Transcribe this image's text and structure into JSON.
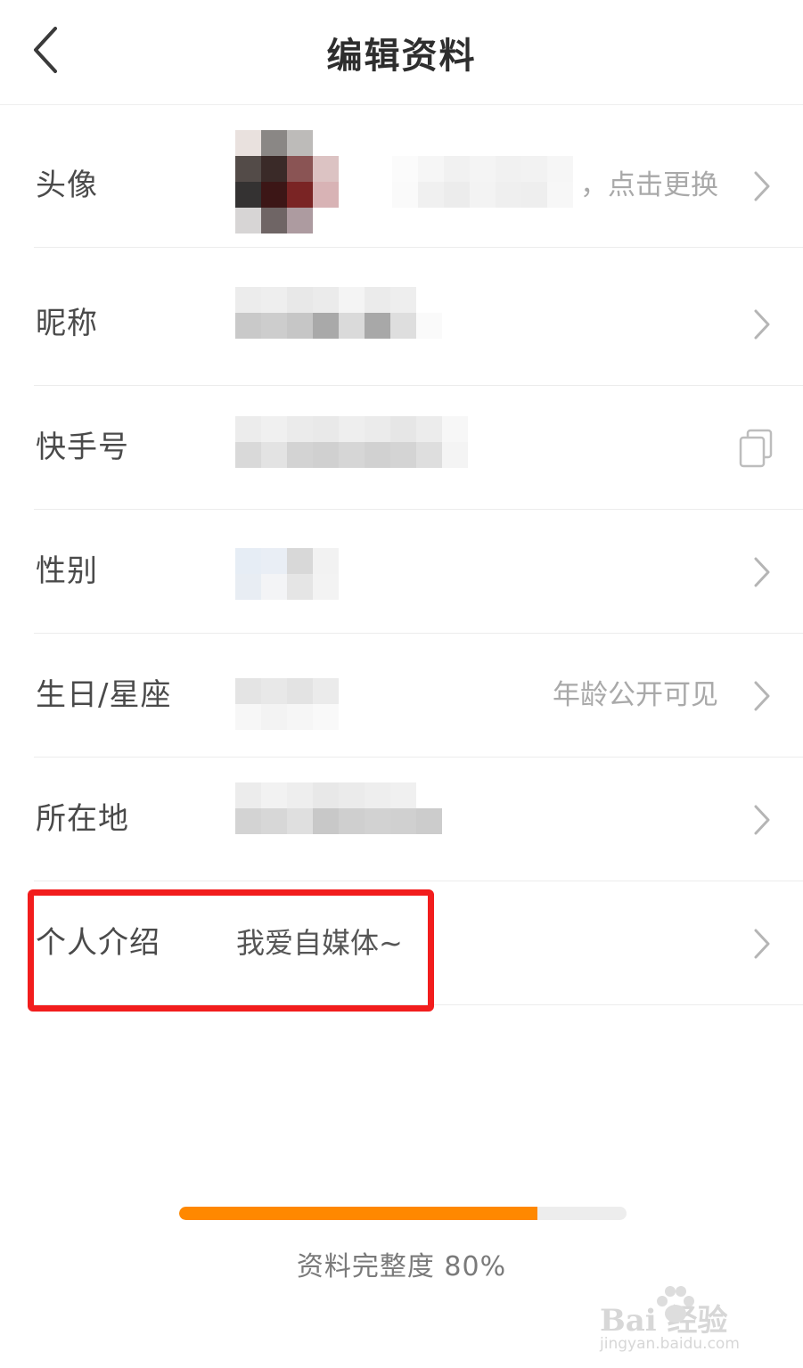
{
  "header": {
    "title": "编辑资料",
    "back_icon": "chevron-left-icon"
  },
  "rows": [
    {
      "label": "头像",
      "hint": "，点击更换"
    },
    {
      "label": "昵称"
    },
    {
      "label": "快手号"
    },
    {
      "label": "性别"
    },
    {
      "label": "生日/星座",
      "hint": "年龄公开可见"
    },
    {
      "label": "所在地"
    },
    {
      "label": "个人介绍",
      "value": "我爱自媒体~"
    }
  ],
  "progress": {
    "label": "资料完整度 80%",
    "fraction": 0.8,
    "color": "#ff8800"
  },
  "highlight": {
    "color": "#f21d1d"
  },
  "watermark": {
    "brand": "Bai  经验",
    "url": "jingyan.baidu.com"
  }
}
